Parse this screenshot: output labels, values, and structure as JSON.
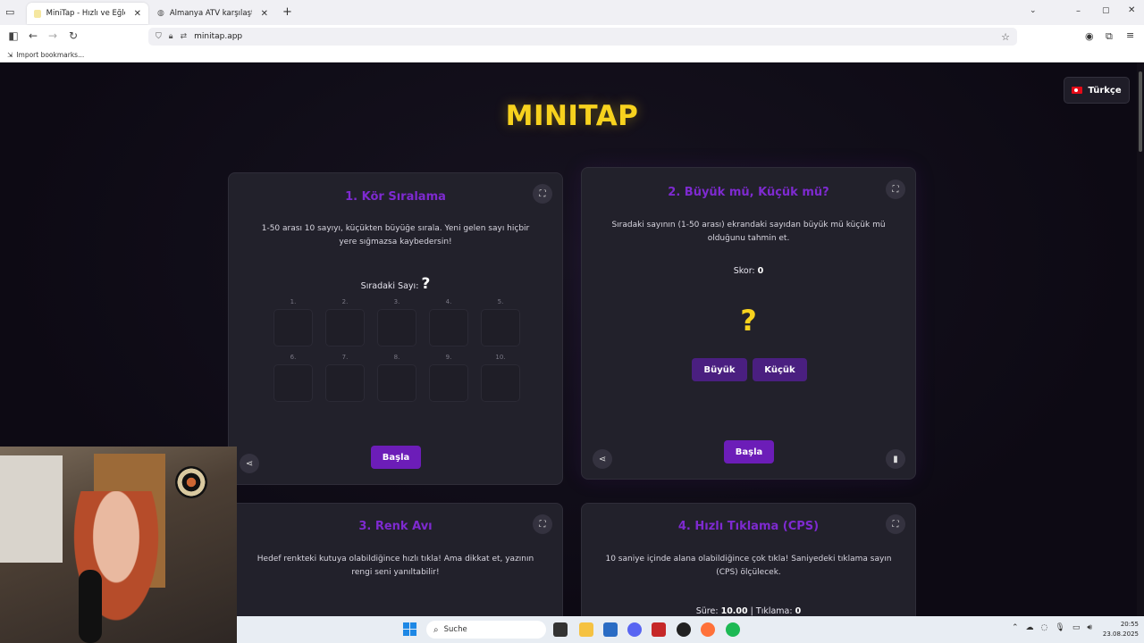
{
  "browser": {
    "tabs": [
      {
        "title": "MiniTap - Hızlı ve Eğlenceli Oyu",
        "active": true
      },
      {
        "title": "Almanya ATV karşılaştırması",
        "active": false
      }
    ],
    "url": "minitap.app",
    "bookmark_label": "Import bookmarks..."
  },
  "page": {
    "logo": "MINITAP",
    "language": "Türkçe"
  },
  "cards": {
    "blind_sort": {
      "title": "1. Kör Sıralama",
      "description": "1-50 arası 10 sayıyı, küçükten büyüğe sırala. Yeni gelen sayı hiçbir yere sığmazsa kaybedersin!",
      "next_label": "Sıradaki Sayı:",
      "next_value": "?",
      "slots": [
        "1.",
        "2.",
        "3.",
        "4.",
        "5.",
        "6.",
        "7.",
        "8.",
        "9.",
        "10."
      ],
      "start_label": "Başla"
    },
    "higher_lower": {
      "title": "2. Büyük mü, Küçük mü?",
      "description": "Sıradaki sayının (1-50 arası) ekrandaki sayıdan büyük mü küçük mü olduğunu tahmin et.",
      "score_label": "Skor:",
      "score_value": "0",
      "current_value": "?",
      "higher_label": "Büyük",
      "lower_label": "Küçük",
      "start_label": "Başla"
    },
    "color_hunt": {
      "title": "3. Renk Avı",
      "description": "Hedef renkteki kutuya olabildiğince hızlı tıkla! Ama dikkat et, yazının rengi seni yanıltabilir!"
    },
    "cps": {
      "title": "4. Hızlı Tıklama (CPS)",
      "description": "10 saniye içinde alana olabildiğince çok tıkla! Saniyedeki tıklama sayın (CPS) ölçülecek.",
      "time_label": "Süre:",
      "time_value": "10.00",
      "clicks_label": "| Tıklama:",
      "clicks_value": "0"
    }
  },
  "taskbar": {
    "search_placeholder": "Suche",
    "time": "20:55",
    "date": "23.08.2025"
  },
  "colors": {
    "accent": "#6c1db8",
    "title": "#7e2ad0",
    "logo": "#f7d21e"
  }
}
